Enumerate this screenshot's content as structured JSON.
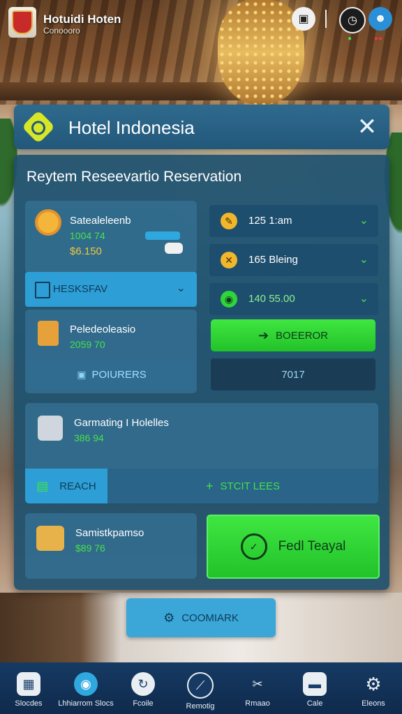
{
  "app": {
    "title": "Hotuidi Hoten",
    "subtitle": "Conoooro"
  },
  "header": {
    "title": "Hotel Indonesia"
  },
  "panel": {
    "title": "Reytem Reseevartio Reservation"
  },
  "left_top": {
    "name": "Satealeleenb",
    "line1": "1004 74",
    "price": "$6.150"
  },
  "dropdown": {
    "label": "HESKSFAV"
  },
  "left_mid": {
    "name": "Peledeoleasio",
    "line1": "2059 70",
    "button": "POIURERS"
  },
  "right_rows": [
    {
      "text": "125 1:am"
    },
    {
      "text": "165 Bleing"
    },
    {
      "text": "140 55.00"
    }
  ],
  "right_buttons": {
    "green": "BOEEROR",
    "dark": "7017"
  },
  "wide": {
    "name": "Garmating I Holelles",
    "value": "386 94",
    "left_button": "REACH",
    "right_button": "STCIT LEES"
  },
  "bottom_card": {
    "name": "Samistkpamso",
    "value": "$89 76",
    "cta": "Fedl Teayal"
  },
  "command_button": "COOMIARK",
  "nav": [
    {
      "label": "Slocdes",
      "icon": "hotel-icon"
    },
    {
      "label": "Lhhiarrom Slocs",
      "icon": "chat-icon"
    },
    {
      "label": "Fcoile",
      "icon": "refresh-icon"
    },
    {
      "label": "Remotig",
      "icon": "route-icon"
    },
    {
      "label": "Rmaao",
      "icon": "tools-icon"
    },
    {
      "label": "Cale",
      "icon": "briefcase-icon"
    },
    {
      "label": "Eleons",
      "icon": "gear-icon"
    }
  ]
}
